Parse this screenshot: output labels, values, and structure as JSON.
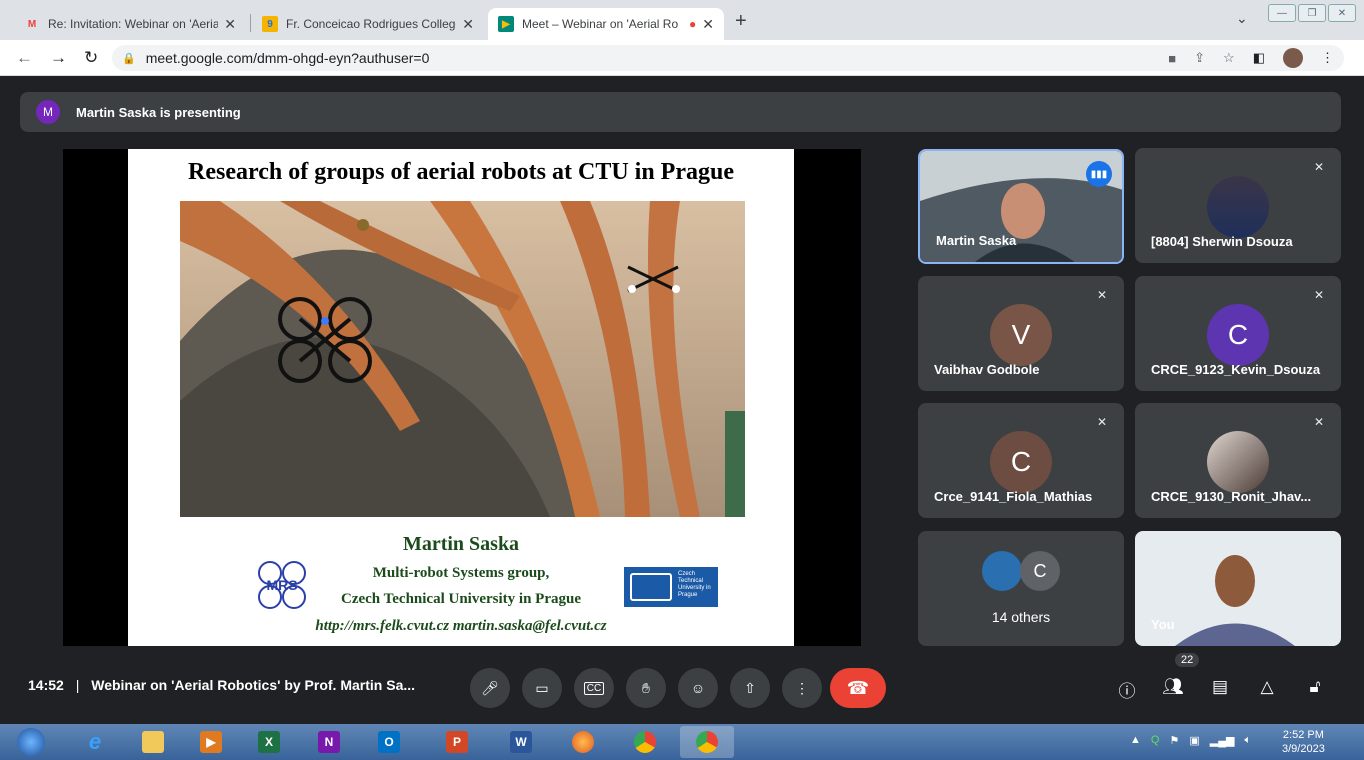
{
  "tabs": [
    {
      "title": "Re: Invitation: Webinar on 'Aerial",
      "icon": "gmail-icon"
    },
    {
      "title": "Fr. Conceicao Rodrigues College",
      "icon": "site-icon"
    },
    {
      "title": "Meet – Webinar on 'Aerial Ro",
      "icon": "meet-icon"
    }
  ],
  "toolbar": {
    "url": "meet.google.com/dmm-ohgd-eyn?authuser=0"
  },
  "presenting": {
    "avatar_letter": "M",
    "text": "Martin Saska is presenting"
  },
  "slide": {
    "title": "Research of groups of aerial robots at CTU in Prague",
    "author": "Martin Saska",
    "group": "Multi-robot Systems group,",
    "university": "Czech Technical University in Prague",
    "links": "http://mrs.felk.cvut.cz   martin.saska@fel.cvut.cz",
    "logo_left": "MRS",
    "logo_right": "Czech Technical University in Prague"
  },
  "participants": [
    {
      "name": "Martin Saska",
      "type": "video",
      "speaking": true
    },
    {
      "name": "[8804] Sherwin Dsouza",
      "type": "photo",
      "muted": true
    },
    {
      "name": "Vaibhav Godbole",
      "letter": "V",
      "color": "#795548",
      "muted": true
    },
    {
      "name": "CRCE_9123_Kevin_Dsouza",
      "letter": "C",
      "color": "#5e35b1",
      "muted": true
    },
    {
      "name": "Crce_9141_Fiola_Mathias",
      "letter": "C",
      "color": "#6d4c41",
      "muted": true
    },
    {
      "name": "CRCE_9130_Ronit_Jhav...",
      "type": "photo",
      "muted": true
    },
    {
      "name": "14 others",
      "letter": "C"
    },
    {
      "name": "You",
      "type": "video"
    }
  ],
  "meeting": {
    "time": "14:52",
    "separator": "|",
    "title": "Webinar on 'Aerial Robotics' by Prof. Martin Sa...",
    "participant_count": "22"
  },
  "taskbar": {
    "time": "2:52 PM",
    "date": "3/9/2023"
  }
}
